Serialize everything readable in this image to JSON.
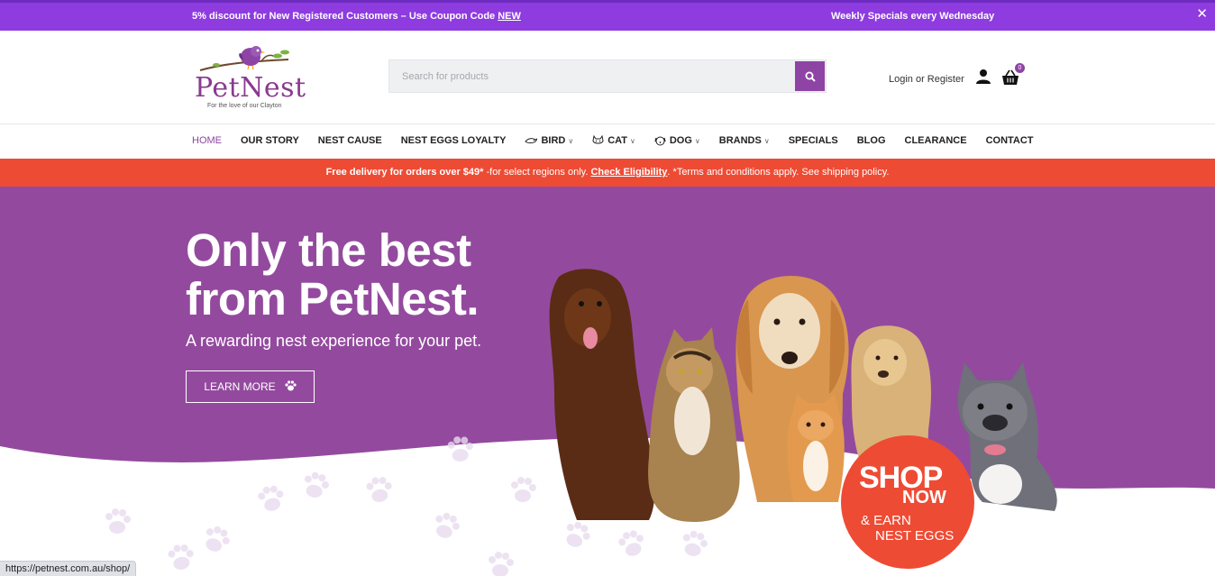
{
  "topbar": {
    "promo_text": "5% discount for New Registered Customers – Use Coupon Code ",
    "promo_code": "NEW",
    "weekly_text": "Weekly Specials every Wednesday",
    "close_symbol": "✕"
  },
  "header": {
    "logo_name": "PetNest",
    "logo_tagline": "For the love of our Clayton",
    "search_placeholder": "Search for products",
    "account_text": "Login or Register",
    "cart_count": "0"
  },
  "nav": {
    "items": [
      {
        "label": "HOME"
      },
      {
        "label": "OUR STORY"
      },
      {
        "label": "NEST CAUSE"
      },
      {
        "label": "NEST EGGS LOYALTY"
      },
      {
        "label": "BIRD"
      },
      {
        "label": "CAT"
      },
      {
        "label": "DOG"
      },
      {
        "label": "BRANDS"
      },
      {
        "label": "SPECIALS"
      },
      {
        "label": "BLOG"
      },
      {
        "label": "CLEARANCE"
      },
      {
        "label": "CONTACT"
      }
    ]
  },
  "delivery": {
    "bold_text": "Free delivery for orders over $49*",
    "mid_text": " -for select regions only. ",
    "link_text": "Check Eligibility",
    "tail_text": ". *Terms and conditions apply. See shipping policy."
  },
  "hero": {
    "headline": "Only the best from PetNest.",
    "subheadline": "A rewarding nest experience for your pet.",
    "button_label": "LEARN MORE",
    "badge_line1": "SHOP",
    "badge_line2": "NOW",
    "badge_line3": "& EARN",
    "badge_line4": "NEST EGGS"
  },
  "status_bar": {
    "url": "https://petnest.com.au/shop/"
  },
  "colors": {
    "topbar": "#8e3be0",
    "brand_purple": "#8e44a5",
    "hero_purple": "#934a9e",
    "accent_orange": "#ee4b34"
  }
}
